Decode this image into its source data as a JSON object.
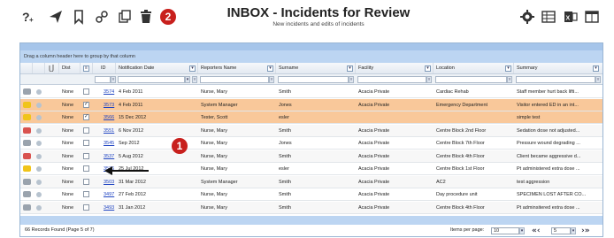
{
  "toolbar": {
    "left_icons": [
      "add-incident-icon",
      "send-icon",
      "bookmark-icon",
      "link-icon",
      "copy-icon",
      "delete-icon"
    ],
    "badge_top": "2",
    "title": "INBOX - Incidents for Review",
    "subtitle": "New incidents and edits of incidents",
    "right_icons": [
      "gear-icon",
      "columns-icon",
      "export-excel-icon",
      "layout-icon"
    ]
  },
  "grid": {
    "group_hint": "Drag a column header here to group by that column",
    "columns": {
      "dist": "Dist",
      "id": "ID",
      "notification_date": "Notification Date",
      "reporters_name": "Reporters Name",
      "surname": "Surname",
      "facility": "Facility",
      "location": "Location",
      "summary": "Summary"
    },
    "rows": [
      {
        "dist": "None",
        "checked": false,
        "id": "3574",
        "date": "4 Feb 2011",
        "reporter": "Nurse, Mary",
        "surname": "Smith",
        "facility": "Acacia Private",
        "location": "Cardiac Rehab",
        "summary": "Staff member hurt back lifti...",
        "status": "grey",
        "selected": false
      },
      {
        "dist": "None",
        "checked": true,
        "id": "3573",
        "date": "4 Feb 2011",
        "reporter": "System Manager",
        "surname": "Jones",
        "facility": "Acacia Private",
        "location": "Emergency Department",
        "summary": "Visitor entered ED in an int...",
        "status": "yellow",
        "selected": true
      },
      {
        "dist": "None",
        "checked": true,
        "id": "3566",
        "date": "15 Dec 2012",
        "reporter": "Tester, Scott",
        "surname": "esler",
        "facility": "",
        "location": "",
        "summary": "simple test",
        "status": "yellow",
        "selected": true
      },
      {
        "dist": "None",
        "checked": false,
        "id": "3551",
        "date": "6 Nov 2012",
        "reporter": "Nurse, Mary",
        "surname": "Smith",
        "facility": "Acacia Private",
        "location": "Centre Block 2nd Floor",
        "summary": "Sedation dose not adjusted...",
        "status": "red",
        "selected": false
      },
      {
        "dist": "None",
        "checked": false,
        "id": "3545",
        "date": "Sep 2012",
        "reporter": "Nurse, Mary",
        "surname": "Jones",
        "facility": "Acacia Private",
        "location": "Centre Block 7th Floor",
        "summary": "Pressure wound degrading ...",
        "status": "grey",
        "selected": false
      },
      {
        "dist": "None",
        "checked": false,
        "id": "3537",
        "date": "5 Aug 2012",
        "reporter": "Nurse, Mary",
        "surname": "Smith",
        "facility": "Acacia Private",
        "location": "Centre Block 4th Floor",
        "summary": "Client became aggressive d...",
        "status": "red",
        "selected": false
      },
      {
        "dist": "None",
        "checked": false,
        "id": "3536",
        "date": "25 Jul 2012",
        "reporter": "Nurse, Mary",
        "surname": "esler",
        "facility": "Acacia Private",
        "location": "Centre Block 1st Floor",
        "summary": "Pt administered extra dose ...",
        "status": "yellow",
        "selected": false
      },
      {
        "dist": "None",
        "checked": false,
        "id": "3503",
        "date": "31 Mar 2012",
        "reporter": "System Manager",
        "surname": "Smith",
        "facility": "Acacia Private",
        "location": "AC2",
        "summary": "test aggression",
        "status": "grey",
        "selected": false
      },
      {
        "dist": "None",
        "checked": false,
        "id": "3497",
        "date": "27 Feb 2012",
        "reporter": "Nurse, Mary",
        "surname": "Smith",
        "facility": "Acacia Private",
        "location": "Day procedure unit",
        "summary": "SPECIMEN LOST AFTER CO...",
        "status": "grey",
        "selected": false
      },
      {
        "dist": "None",
        "checked": false,
        "id": "3493",
        "date": "31 Jan 2012",
        "reporter": "Nurse, Mary",
        "surname": "Smith",
        "facility": "Acacia Private",
        "location": "Centre Block 4th Floor",
        "summary": "Pt adminsitered extra dose ...",
        "status": "grey",
        "selected": false
      }
    ],
    "records_found": "66 Records Found (Page 5 of 7)",
    "items_per_page_label": "Items per page:",
    "items_per_page_value": "10",
    "page_input": "5",
    "prev_label": "«‹",
    "next_label": "›»"
  },
  "annotation": {
    "badge_label": "1"
  },
  "colors": {
    "selected_row": "#f9c89a",
    "header_blue": "#bcd5f2",
    "badge_red": "#c8201d",
    "link_blue": "#1f44c2"
  }
}
